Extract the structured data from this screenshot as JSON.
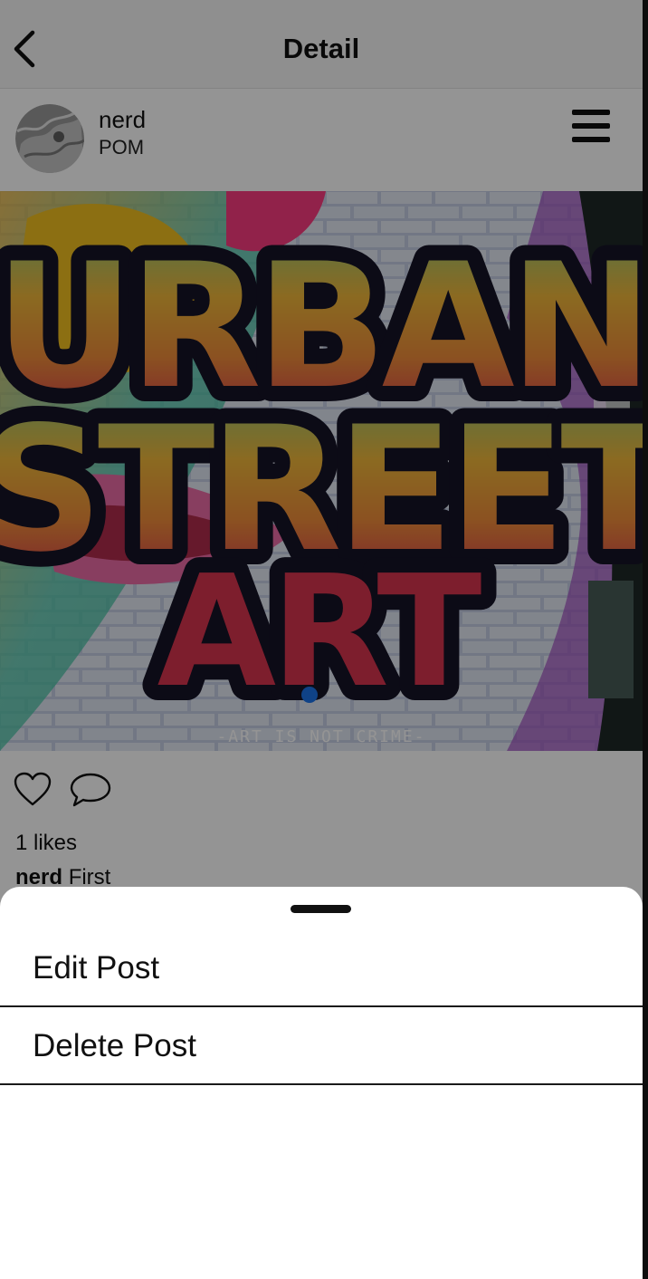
{
  "nav": {
    "title": "Detail",
    "back_icon": "chevron-left-icon"
  },
  "post": {
    "username": "nerd",
    "subtitle": "POM",
    "menu_icon": "hamburger-menu-icon",
    "image": {
      "line1": "URBAN",
      "line2": "STREET",
      "line3": "ART",
      "tagline": "-ART IS NOT CRIME-"
    },
    "likes_text": "1 likes",
    "caption_user": "nerd",
    "caption_text": "First"
  },
  "sheet": {
    "items": [
      {
        "label": "Edit Post"
      },
      {
        "label": "Delete Post"
      }
    ]
  },
  "colors": {
    "overlay": "#000000",
    "sheet": "#ffffff",
    "accent": "#1a73e8"
  }
}
